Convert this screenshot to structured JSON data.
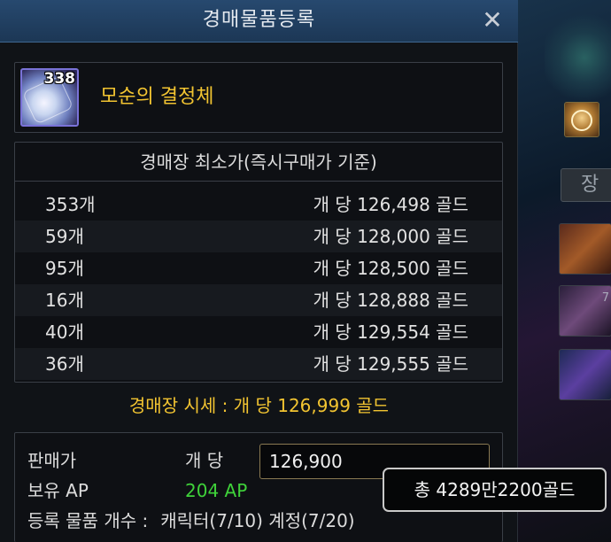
{
  "dialog": {
    "title": "경매물품등록",
    "close_glyph": "✕"
  },
  "item": {
    "name": "모순의 결정체",
    "stack_count": "338"
  },
  "price_table": {
    "header": "경매장 최소가(즉시구매가 기준)",
    "rows": [
      {
        "count": "353개",
        "per_unit": "개 당 126,498 골드"
      },
      {
        "count": "59개",
        "per_unit": "개 당 128,000 골드"
      },
      {
        "count": "95개",
        "per_unit": "개 당 128,500 골드"
      },
      {
        "count": "16개",
        "per_unit": "개 당 128,888 골드"
      },
      {
        "count": "40개",
        "per_unit": "개 당 129,554 골드"
      },
      {
        "count": "36개",
        "per_unit": "개 당 129,555 골드"
      }
    ]
  },
  "market_price": "경매장 시세 : 개 당 126,999 골드",
  "sell": {
    "price_label": "판매가",
    "per_unit_label": "개 당",
    "price_value": "126,900",
    "ap_label": "보유 AP",
    "ap_value": "204 AP",
    "register_count_label": "등록 물품 개수 :",
    "register_count_value": "캐릭터(7/10) 계정(7/20)"
  },
  "tooltip": {
    "total": "총 4289만2200골드"
  },
  "background": {
    "tab_fragment": "장",
    "thumb_fragment": "7"
  },
  "colors": {
    "title_bar": "#1c3755",
    "item_name": "#f2c431",
    "market_price": "#f2c431",
    "ap_value": "#3fd23a",
    "input_border": "#8a7a52"
  }
}
